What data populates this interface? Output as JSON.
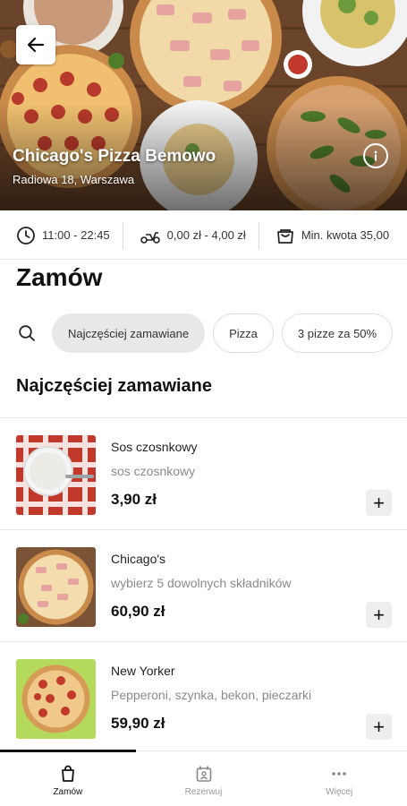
{
  "restaurant": {
    "name": "Chicago's Pizza Bemowo",
    "address": "Radiowa 18, Warszawa"
  },
  "info": {
    "hours": "11:00 - 22:45",
    "delivery_fee": "0,00 zł - 4,00 zł",
    "min_amount": "Min. kwota 35,00"
  },
  "order": {
    "title": "Zamów"
  },
  "chips": [
    {
      "label": "Najczęściej zamawiane",
      "active": true
    },
    {
      "label": "Pizza",
      "active": false
    },
    {
      "label": "3 pizze za 50%",
      "active": false
    }
  ],
  "section": {
    "title": "Najczęściej zamawiane"
  },
  "items": [
    {
      "name": "Sos czosnkowy",
      "description": "sos czosnkowy",
      "price": "3,90 zł",
      "add_label": "+"
    },
    {
      "name": "Chicago's",
      "description": "wybierz 5 dowolnych składników",
      "price": "60,90 zł",
      "add_label": "+"
    },
    {
      "name": "New Yorker",
      "description": "Pepperoni, szynka, bekon, pieczarki",
      "price": "59,90 zł",
      "add_label": "+"
    }
  ],
  "nav": {
    "tabs": [
      {
        "label": "Zamów",
        "icon": "bag-icon",
        "active": true
      },
      {
        "label": "Rezerwuj",
        "icon": "calendar-person-icon",
        "active": false
      },
      {
        "label": "Więcej",
        "icon": "more-dots-icon",
        "active": false
      }
    ]
  },
  "colors": {
    "accent": "#111111",
    "chip_active_bg": "#e8e8e8",
    "muted_text": "#8a8a8a"
  }
}
